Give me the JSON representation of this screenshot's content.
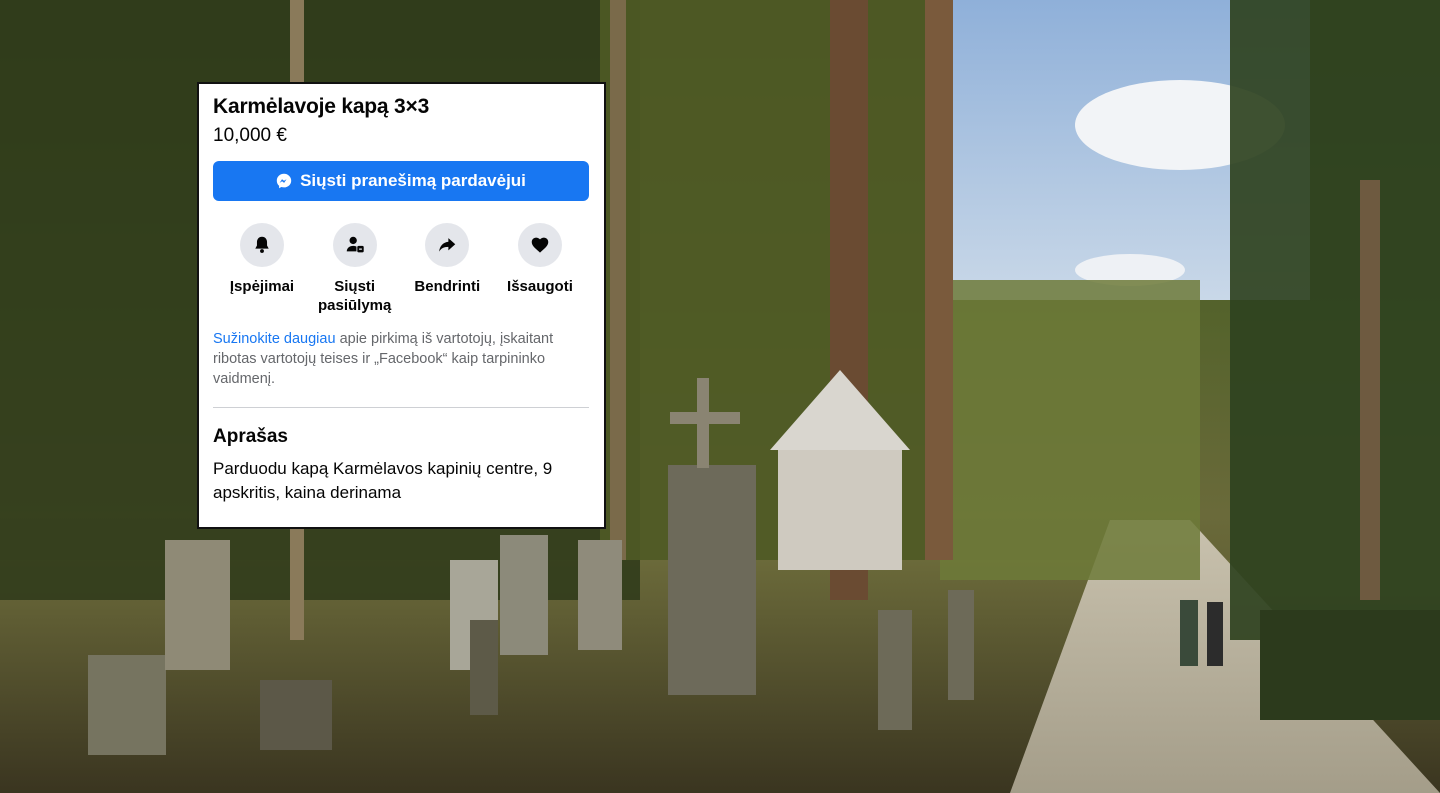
{
  "listing": {
    "title": "Karmėlavoje kapą 3×3",
    "price": "10,000 €",
    "message_button_label": "Siųsti pranešimą pardavėjui",
    "actions": [
      {
        "label": "Įspėjimai",
        "icon": "bell-icon"
      },
      {
        "label": "Siųsti pasiūlymą",
        "icon": "offer-icon"
      },
      {
        "label": "Bendrinti",
        "icon": "share-icon"
      },
      {
        "label": "Išsaugoti",
        "icon": "heart-icon"
      }
    ],
    "info_link": "Sužinokite daugiau",
    "info_text": " apie pirkimą iš vartotojų, įskaitant ribotas vartotojų teises ir „Facebook“ kaip tarpininko vaidmenį.",
    "description_heading": "Aprašas",
    "description_text": "Parduodu kapą Karmėlavos kapinių centre, 9 apskritis, kaina derinama"
  },
  "colors": {
    "accent": "#1877f2",
    "icon_bg": "#e4e6eb",
    "secondary_text": "#65676b"
  }
}
